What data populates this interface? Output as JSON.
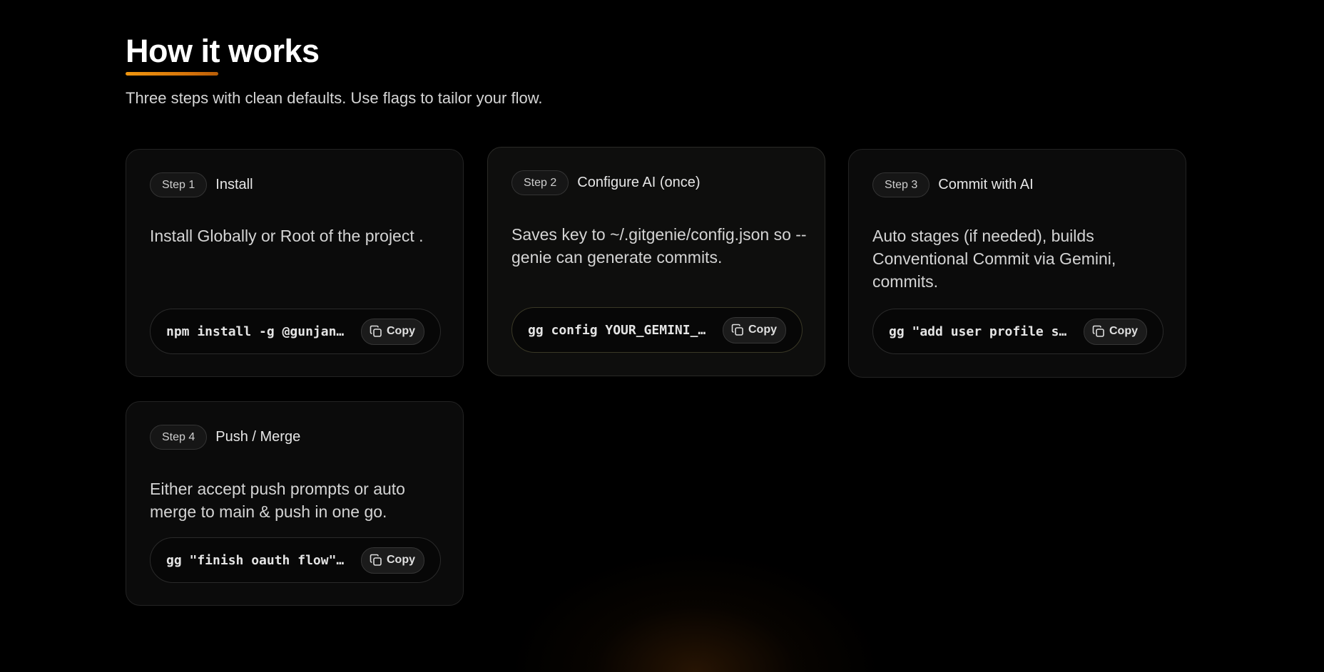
{
  "section": {
    "title": "How it works",
    "subtitle": "Three steps with clean defaults. Use flags to tailor your flow."
  },
  "steps": [
    {
      "badge": "Step 1",
      "title": "Install",
      "description": "Install Globally or Root of the project .",
      "command": "npm install -g @gunjanghate/gitgenie",
      "copy_label": "Copy"
    },
    {
      "badge": "Step 2",
      "title": "Configure AI (once)",
      "description": "Saves key to ~/.gitgenie/config.json so --genie can generate commits.",
      "command": "gg config YOUR_GEMINI_API_KEY",
      "copy_label": "Copy"
    },
    {
      "badge": "Step 3",
      "title": "Commit with AI",
      "description": "Auto stages (if needed), builds Conventional Commit via Gemini, commits.",
      "command": "gg \"add user profile section\" --genie",
      "copy_label": "Copy"
    },
    {
      "badge": "Step 4",
      "title": "Push / Merge",
      "description": "Either accept push prompts or auto merge to main & push in one go.",
      "command": "gg \"finish oauth flow\" --genie --merge",
      "copy_label": "Copy"
    }
  ],
  "icons": {
    "copy": "copy-icon"
  },
  "colors": {
    "accent": "#e8850c",
    "background": "#000000",
    "card": "#0b0b0b"
  }
}
